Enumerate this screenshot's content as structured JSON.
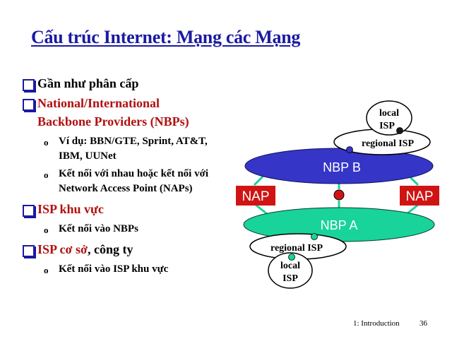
{
  "slide": {
    "title": "Cấu trúc Internet: Mạng các Mạng",
    "bullets": {
      "b1": "Gần như phân cấp",
      "b2_line1": "National/International",
      "b2_line2": "Backbone Providers (NBPs)",
      "b2_sub1_line1": "Ví dụ: BBN/GTE, Sprint, AT&T,",
      "b2_sub1_line2": "IBM, UUNet",
      "b2_sub2_line1": "Kết nối với nhau hoặc kết nối với",
      "b2_sub2_line2": "Network Access Point (NAPs)",
      "b3": "ISP khu vực",
      "b3_sub1": "Kết nối vào NBPs",
      "b4_red": "ISP cơ sở",
      "b4_rest": ", công ty",
      "b4_sub1": "Kết nối vào ISP khu vực"
    },
    "sub_marker": "o",
    "diagram": {
      "nbp_b": "NBP B",
      "nbp_a": "NBP A",
      "nap_left": "NAP",
      "nap_right": "NAP",
      "regional_isp_top": "regional ISP",
      "regional_isp_bottom": "regional ISP",
      "local_isp_top_line1": "local",
      "local_isp_top_line2": "ISP",
      "local_isp_bottom_line1": "local",
      "local_isp_bottom_line2": "ISP",
      "colors": {
        "nbp_b_fill": "#3535c8",
        "nbp_a_fill": "#18d49a",
        "nap_fill": "#d01414",
        "link_color": "#18d49a"
      }
    },
    "footer": {
      "section": "1: Introduction",
      "page": "36"
    },
    "colors": {
      "title": "#1a1aa0",
      "accent_red": "#b01010",
      "bullet_box": "#1a1aa0"
    }
  }
}
